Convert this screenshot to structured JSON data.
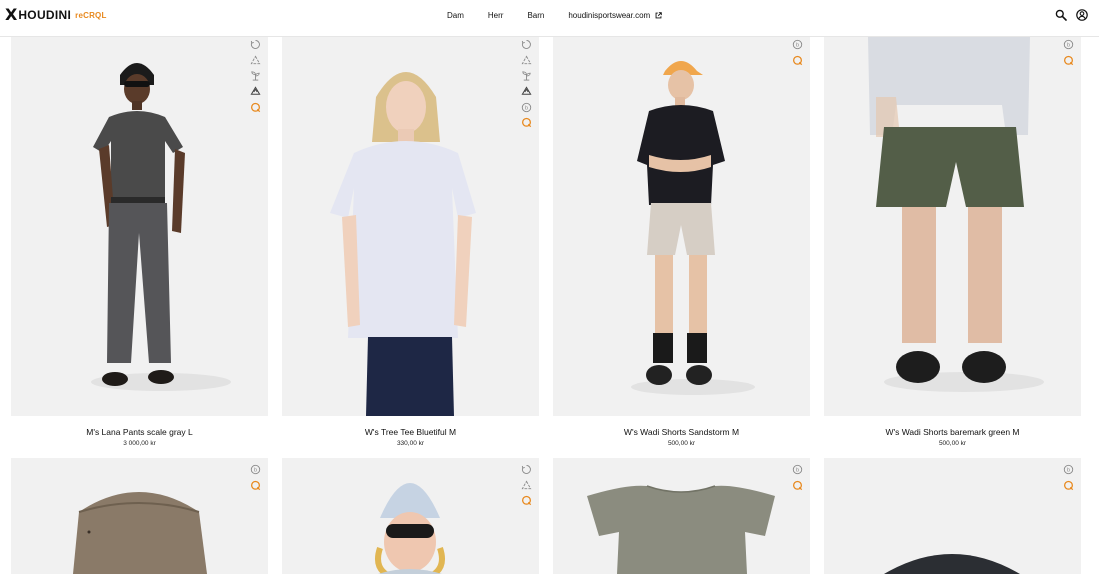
{
  "header": {
    "logo": {
      "mark": "X",
      "brand": "HOUDINI",
      "sub": "reCRQL"
    },
    "nav": [
      {
        "label": "Dam"
      },
      {
        "label": "Herr"
      },
      {
        "label": "Barn"
      },
      {
        "label": "houdinisportswear.com",
        "external": true
      }
    ],
    "icons": [
      "search-icon",
      "account-icon"
    ]
  },
  "colors": {
    "accent": "#e8891e",
    "photo_bg": "#f1f1f1",
    "icon_gray": "#8a8a8a"
  },
  "products": [
    {
      "title": "M's Lana Pants scale gray L",
      "price": "3 000,00 kr",
      "badges": [
        "circular-icon",
        "recycle-icon",
        "plant-icon",
        "recycled-icon",
        "recrql-icon"
      ]
    },
    {
      "title": "W's Tree Tee Bluetiful M",
      "price": "330,00 kr",
      "badges": [
        "circular-icon",
        "recycle-icon",
        "plant-icon",
        "recycled-icon",
        "biodegradable-icon",
        "recrql-icon"
      ]
    },
    {
      "title": "W's Wadi Shorts Sandstorm M",
      "price": "500,00 kr",
      "badges": [
        "biodegradable-icon",
        "recrql-icon"
      ]
    },
    {
      "title": "W's Wadi Shorts baremark green M",
      "price": "500,00 kr",
      "badges": [
        "biodegradable-icon",
        "recrql-icon"
      ]
    },
    {
      "title": "",
      "price": "",
      "badges": [
        "biodegradable-icon",
        "recrql-icon"
      ]
    },
    {
      "title": "",
      "price": "",
      "badges": [
        "circular-icon",
        "recycle-icon",
        "recrql-icon"
      ]
    },
    {
      "title": "",
      "price": "",
      "badges": [
        "biodegradable-icon",
        "recrql-icon"
      ]
    },
    {
      "title": "",
      "price": "",
      "badges": [
        "biodegradable-icon",
        "recrql-icon"
      ]
    }
  ]
}
